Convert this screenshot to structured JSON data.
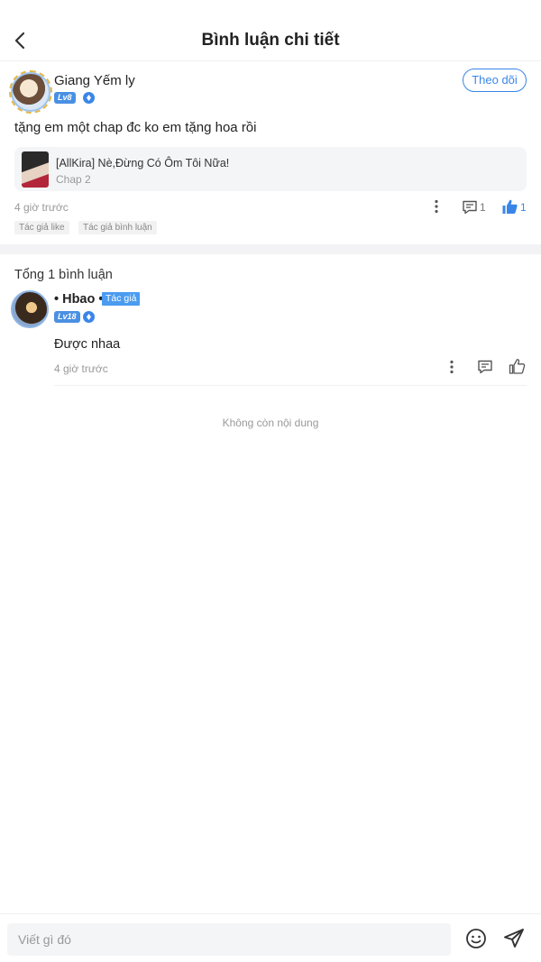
{
  "header": {
    "title": "Bình luận chi tiết",
    "back_icon": "chevron-left-icon"
  },
  "post": {
    "username": "Giang Yếm ly",
    "level": "Lv8",
    "follow_label": "Theo dõi",
    "text": "tặng em một chap đc ko em tặng hoa rồi",
    "chapter": {
      "title": "[AllKira] Nè,Đừng Có Ôm Tôi Nữa!",
      "subtitle": "Chap 2"
    },
    "time": "4 giờ trước",
    "comment_count": "1",
    "like_count": "1",
    "tags": [
      "Tác giả like",
      "Tác giả bình luận"
    ]
  },
  "replies": {
    "total_label": "Tổng 1 bình luận",
    "items": [
      {
        "name": "• Hbao •",
        "author_badge": "Tác giả",
        "level": "Lv18",
        "text": "Được nhaa",
        "time": "4 giờ trước"
      }
    ]
  },
  "end_text": "Không còn nội dung",
  "composer": {
    "placeholder": "Viết gì đó"
  },
  "colors": {
    "accent": "#3a86e8",
    "badge": "#4a90e2",
    "muted": "#999999"
  }
}
